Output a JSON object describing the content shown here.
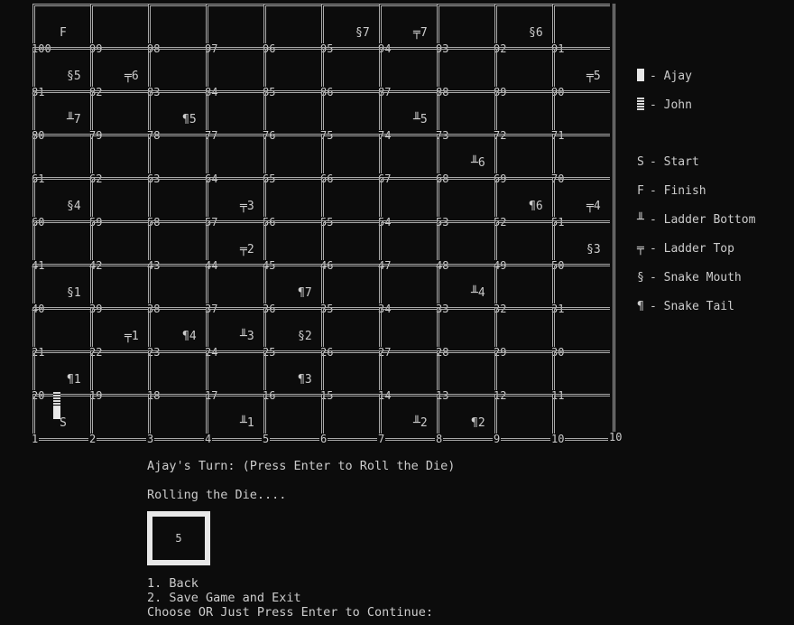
{
  "board": {
    "rows": [
      [
        100,
        99,
        98,
        97,
        96,
        95,
        94,
        93,
        92,
        91
      ],
      [
        81,
        82,
        83,
        84,
        85,
        86,
        87,
        88,
        89,
        90
      ],
      [
        80,
        79,
        78,
        77,
        76,
        75,
        74,
        73,
        72,
        71
      ],
      [
        61,
        62,
        63,
        64,
        65,
        66,
        67,
        68,
        69,
        70
      ],
      [
        60,
        59,
        58,
        57,
        56,
        55,
        54,
        53,
        52,
        51
      ],
      [
        41,
        42,
        43,
        44,
        45,
        46,
        47,
        48,
        49,
        50
      ],
      [
        40,
        39,
        38,
        37,
        36,
        35,
        34,
        33,
        32,
        31
      ],
      [
        21,
        22,
        23,
        24,
        25,
        26,
        27,
        28,
        29,
        30
      ],
      [
        20,
        19,
        18,
        17,
        16,
        15,
        14,
        13,
        12,
        11
      ],
      [
        1,
        2,
        3,
        4,
        5,
        6,
        7,
        8,
        9,
        10
      ]
    ],
    "last_number": "10",
    "marks": [
      {
        "row": 0,
        "col": 0,
        "text": "F"
      },
      {
        "row": 0,
        "col": 5,
        "text": "§7"
      },
      {
        "row": 0,
        "col": 6,
        "text": "╤7"
      },
      {
        "row": 0,
        "col": 8,
        "text": "§6"
      },
      {
        "row": 1,
        "col": 0,
        "text": "§5"
      },
      {
        "row": 1,
        "col": 1,
        "text": "╤6"
      },
      {
        "row": 1,
        "col": 9,
        "text": "╤5"
      },
      {
        "row": 2,
        "col": 0,
        "text": "╨7"
      },
      {
        "row": 2,
        "col": 2,
        "text": "¶5"
      },
      {
        "row": 2,
        "col": 6,
        "text": "╨5"
      },
      {
        "row": 3,
        "col": 7,
        "text": "╨6"
      },
      {
        "row": 4,
        "col": 0,
        "text": "§4"
      },
      {
        "row": 4,
        "col": 3,
        "text": "╤3"
      },
      {
        "row": 4,
        "col": 8,
        "text": "¶6"
      },
      {
        "row": 4,
        "col": 9,
        "text": "╤4"
      },
      {
        "row": 5,
        "col": 3,
        "text": "╤2"
      },
      {
        "row": 5,
        "col": 9,
        "text": "§3"
      },
      {
        "row": 6,
        "col": 0,
        "text": "§1"
      },
      {
        "row": 6,
        "col": 4,
        "text": "¶7"
      },
      {
        "row": 6,
        "col": 7,
        "text": "╨4"
      },
      {
        "row": 7,
        "col": 1,
        "text": "╤1"
      },
      {
        "row": 7,
        "col": 2,
        "text": "¶4"
      },
      {
        "row": 7,
        "col": 3,
        "text": "╨3"
      },
      {
        "row": 7,
        "col": 4,
        "text": "§2"
      },
      {
        "row": 8,
        "col": 0,
        "text": "¶1"
      },
      {
        "row": 8,
        "col": 4,
        "text": "¶3"
      },
      {
        "row": 9,
        "col": 0,
        "text": "S"
      },
      {
        "row": 9,
        "col": 3,
        "text": "╨1"
      },
      {
        "row": 9,
        "col": 6,
        "text": "╨2"
      },
      {
        "row": 9,
        "col": 7,
        "text": "¶2"
      }
    ],
    "tokens": {
      "ajay_square": 1,
      "john_square": 1
    }
  },
  "legend": {
    "players": [
      {
        "name": "- Ajay",
        "token": "ajay"
      },
      {
        "name": "- John",
        "token": "john"
      }
    ],
    "symbols": [
      {
        "symbol": "S",
        "label": "- Start"
      },
      {
        "symbol": "F",
        "label": "- Finish"
      },
      {
        "symbol": "╨",
        "label": "- Ladder Bottom"
      },
      {
        "symbol": "╤",
        "label": "- Ladder Top"
      },
      {
        "symbol": "§",
        "label": "- Snake Mouth"
      },
      {
        "symbol": "¶",
        "label": "- Snake Tail"
      }
    ]
  },
  "console": {
    "turn_prompt": "Ajay's Turn: (Press Enter to Roll the Die)",
    "rolling": "Rolling the Die....",
    "die_value": "5"
  },
  "menu": {
    "option_back": "1. Back",
    "option_save": "2. Save Game and Exit",
    "prompt": "Choose OR Just Press Enter to Continue:"
  }
}
